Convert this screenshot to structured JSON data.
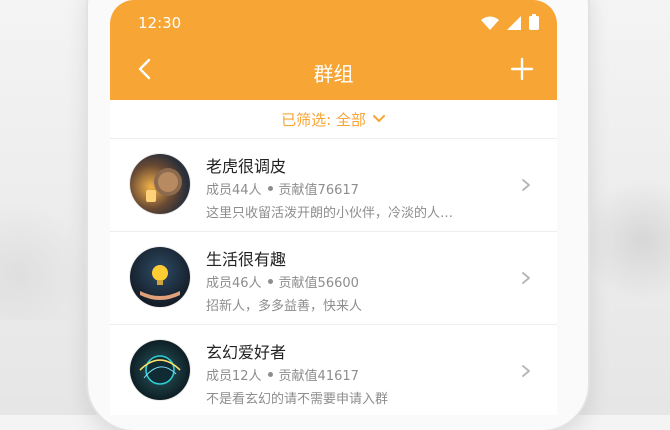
{
  "status": {
    "time": "12:30"
  },
  "header": {
    "title": "群组"
  },
  "filter": {
    "label": "已筛选: 全部"
  },
  "groups": [
    {
      "name": "老虎很调皮",
      "members": "成员44人",
      "contrib": "贡献值76617",
      "desc": "这里只收留活泼开朗的小伙伴，冷淡的人…"
    },
    {
      "name": "生活很有趣",
      "members": "成员46人",
      "contrib": "贡献值56600",
      "desc": "招新人，多多益善，快来人"
    },
    {
      "name": "玄幻爱好者",
      "members": "成员12人",
      "contrib": "贡献值41617",
      "desc": "不是看玄幻的请不需要申请入群"
    }
  ],
  "colors": {
    "accent": "#f7a535",
    "text": "#222222",
    "muted": "#8d8d8d"
  },
  "icons": {
    "back": "chevron-left-icon",
    "add": "plus-icon",
    "filter_caret": "chevron-down-icon",
    "row_chevron": "chevron-right-icon",
    "wifi": "wifi-icon",
    "signal": "signal-icon",
    "battery": "battery-icon"
  }
}
